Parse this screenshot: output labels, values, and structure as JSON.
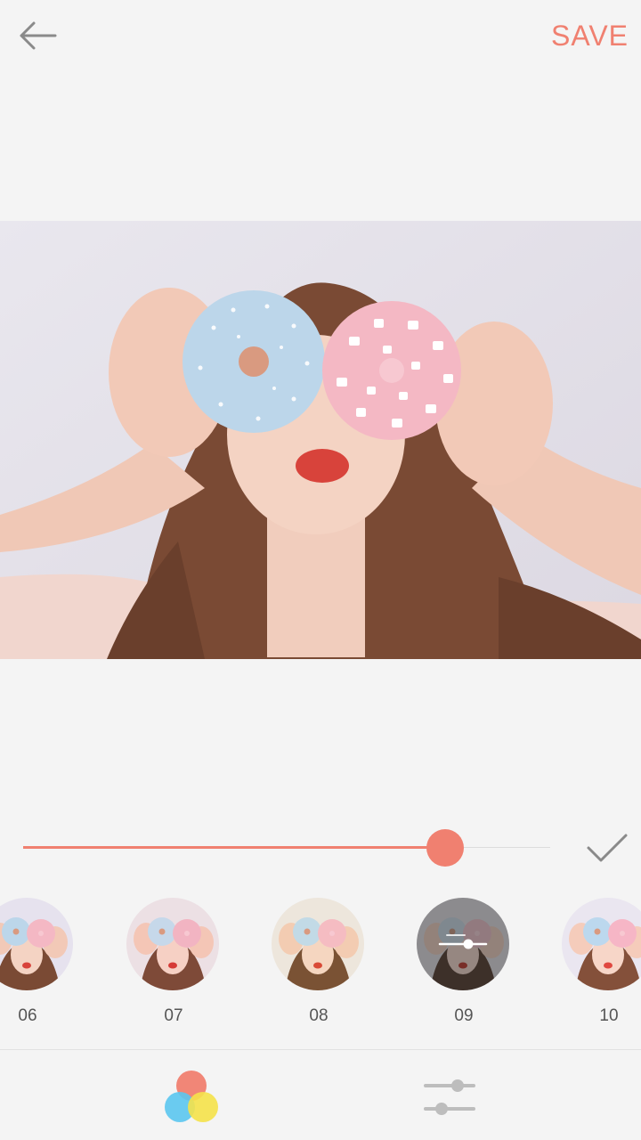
{
  "header": {
    "back_icon": "arrow-left-icon",
    "save_label": "SAVE"
  },
  "colors": {
    "accent": "#f08070",
    "background": "#f4f4f4",
    "text": "#555555"
  },
  "slider": {
    "value": 0.8,
    "confirm_icon": "checkmark-icon"
  },
  "filters": {
    "items": [
      {
        "label": "06",
        "selected": false
      },
      {
        "label": "07",
        "selected": false
      },
      {
        "label": "08",
        "selected": false
      },
      {
        "label": "09",
        "selected": true
      },
      {
        "label": "10",
        "selected": false
      }
    ]
  },
  "bottom_tabs": [
    {
      "icon": "filter-circles-icon",
      "active": true
    },
    {
      "icon": "adjust-sliders-icon",
      "active": false
    }
  ]
}
